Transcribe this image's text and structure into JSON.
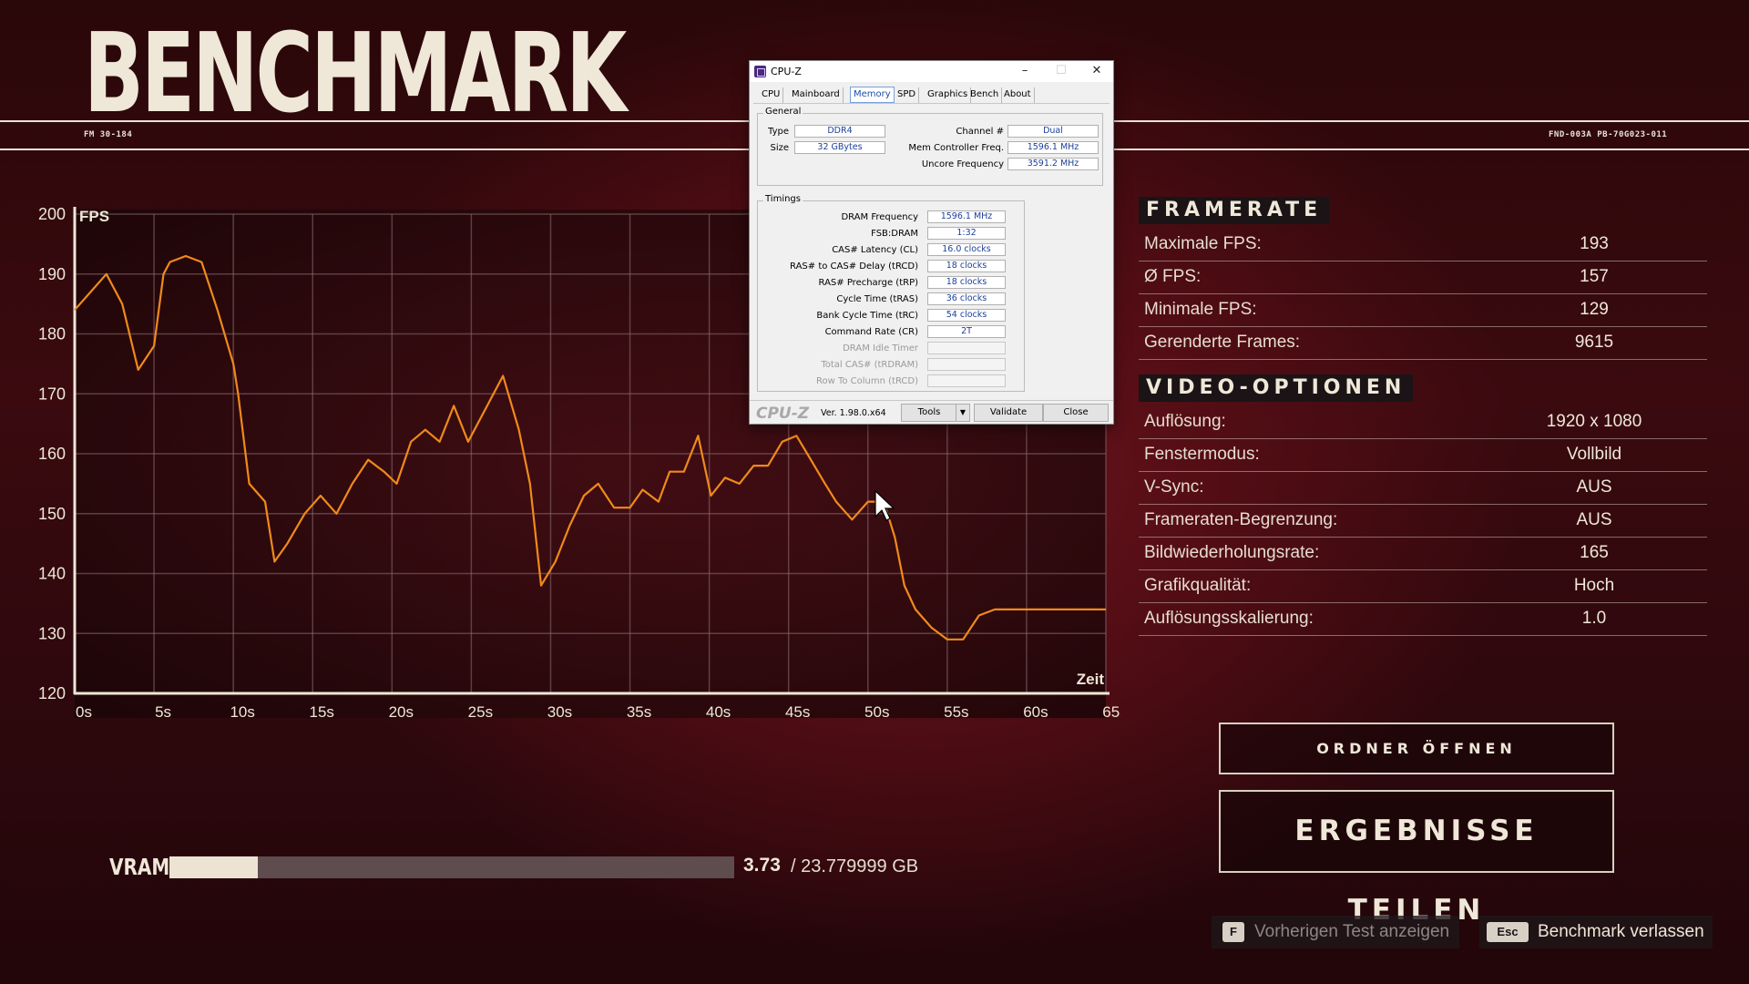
{
  "header": {
    "title": "BENCHMARK",
    "code_left": "FM 30-184",
    "code_right": "FND-003A PB-70G023-011"
  },
  "chart_data": {
    "type": "line",
    "title": "",
    "xlabel": "Zeit",
    "ylabel": "FPS",
    "xlim": [
      0,
      65
    ],
    "ylim": [
      120,
      200
    ],
    "grid": true,
    "x_ticks": [
      "0s",
      "5s",
      "10s",
      "15s",
      "20s",
      "25s",
      "30s",
      "35s",
      "40s",
      "45s",
      "50s",
      "55s",
      "60s",
      "65s"
    ],
    "y_ticks": [
      200,
      190,
      180,
      170,
      160,
      150,
      140,
      130,
      120
    ],
    "color": "#f08a1a",
    "series": [
      {
        "x": [
          0,
          1,
          2,
          3,
          4,
          5,
          5.6,
          6,
          7,
          8,
          9,
          10,
          10.3,
          11,
          12,
          12.6,
          13.4,
          14.5,
          15.5,
          16.5,
          17.5,
          18.5,
          19.5,
          20.3,
          21.2,
          22.1,
          23,
          23.9,
          24.8,
          26,
          27,
          28,
          28.7,
          29.4,
          30.3,
          31.2,
          32.1,
          33,
          34,
          35,
          35.8,
          36.8,
          37.5,
          38.4,
          39.3,
          40.1,
          41,
          41.9,
          42.8,
          43.7,
          44.6,
          45.5,
          46.4,
          47.3,
          48,
          49,
          50,
          51,
          51.7,
          52.3,
          53,
          54,
          55,
          56,
          57,
          58,
          59,
          60,
          61,
          62,
          63,
          64,
          65
        ],
        "y": [
          184,
          187,
          190,
          185,
          174,
          178,
          190,
          192,
          193,
          192,
          184,
          175,
          170,
          155,
          152,
          142,
          145,
          150,
          153,
          150,
          155,
          159,
          157,
          155,
          162,
          164,
          162,
          168,
          162,
          168,
          173,
          164,
          155,
          138,
          142,
          148,
          153,
          155,
          151,
          151,
          154,
          152,
          157,
          157,
          163,
          153,
          156,
          155,
          158,
          158,
          162,
          163,
          159,
          155,
          152,
          149,
          152,
          152,
          146,
          138,
          134,
          131,
          129,
          129,
          133,
          134,
          134,
          134,
          134,
          134,
          134,
          134,
          134
        ]
      }
    ]
  },
  "framerate": {
    "title": "FRAMERATE",
    "rows": [
      {
        "label": "Maximale FPS:",
        "value": "193"
      },
      {
        "label": "Ø FPS:",
        "value": "157"
      },
      {
        "label": "Minimale FPS:",
        "value": "129"
      },
      {
        "label": "Gerenderte Frames:",
        "value": "9615"
      }
    ]
  },
  "video": {
    "title": "VIDEO-OPTIONEN",
    "rows": [
      {
        "label": "Auflösung:",
        "value": "1920 x 1080"
      },
      {
        "label": "Fenstermodus:",
        "value": "Vollbild"
      },
      {
        "label": "V-Sync:",
        "value": "AUS"
      },
      {
        "label": "Frameraten-Begrenzung:",
        "value": "AUS"
      },
      {
        "label": "Bildwiederholungsrate:",
        "value": "165"
      },
      {
        "label": "Grafikqualität:",
        "value": "Hoch"
      },
      {
        "label": "Auflösungsskalierung:",
        "value": "1.0"
      }
    ]
  },
  "buttons": {
    "open_folder": "ORDNER ÖFFNEN",
    "share": "ERGEBNISSE TEILEN"
  },
  "hints": {
    "prev_key": "F",
    "prev_label": "Vorherigen Test anzeigen",
    "exit_key": "Esc",
    "exit_label": "Benchmark verlassen"
  },
  "vram": {
    "label": "VRAM",
    "used": "3.73",
    "total": "/ 23.779999 GB",
    "fraction": 0.157
  },
  "cpuz": {
    "title": "CPU-Z",
    "tabs": [
      "CPU",
      "Mainboard",
      "Memory",
      "SPD",
      "Graphics",
      "Bench",
      "About"
    ],
    "active_tab": "Memory",
    "general": {
      "title": "General",
      "type_label": "Type",
      "type_value": "DDR4",
      "size_label": "Size",
      "size_value": "32 GBytes",
      "channel_label": "Channel #",
      "channel_value": "Dual",
      "mcf_label": "Mem Controller Freq.",
      "mcf_value": "1596.1 MHz",
      "uncore_label": "Uncore Frequency",
      "uncore_value": "3591.2 MHz"
    },
    "timings": {
      "title": "Timings",
      "rows": [
        {
          "label": "DRAM Frequency",
          "value": "1596.1 MHz"
        },
        {
          "label": "FSB:DRAM",
          "value": "1:32"
        },
        {
          "label": "CAS# Latency (CL)",
          "value": "16.0 clocks"
        },
        {
          "label": "RAS# to CAS# Delay (tRCD)",
          "value": "18 clocks"
        },
        {
          "label": "RAS# Precharge (tRP)",
          "value": "18 clocks"
        },
        {
          "label": "Cycle Time (tRAS)",
          "value": "36 clocks"
        },
        {
          "label": "Bank Cycle Time (tRC)",
          "value": "54 clocks"
        },
        {
          "label": "Command Rate (CR)",
          "value": "2T"
        },
        {
          "label": "DRAM Idle Timer",
          "value": ""
        },
        {
          "label": "Total CAS# (tRDRAM)",
          "value": ""
        },
        {
          "label": "Row To Column (tRCD)",
          "value": ""
        }
      ]
    },
    "footer": {
      "brand": "CPU-Z",
      "version": "Ver. 1.98.0.x64",
      "tools": "Tools",
      "validate": "Validate",
      "close": "Close"
    }
  }
}
